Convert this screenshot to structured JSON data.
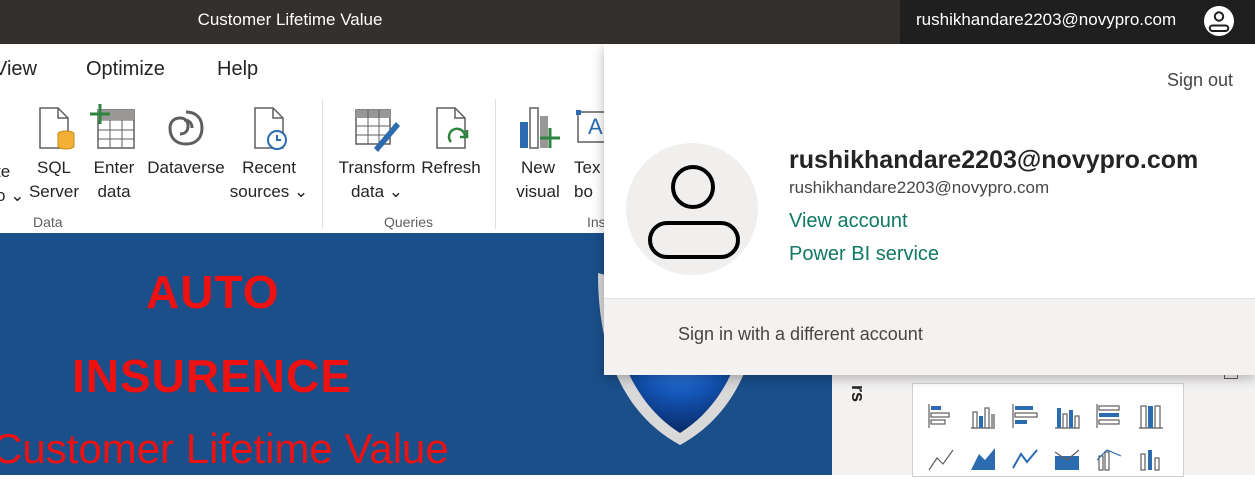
{
  "window": {
    "title": "Customer Lifetime Value"
  },
  "account": {
    "email": "rushikhandare2203@novypro.com",
    "display_name": "rushikhandare2203@novypro.com",
    "sub_email": "rushikhandare2203@novypro.com",
    "sign_out": "Sign out",
    "view_account": "View account",
    "power_bi_service": "Power BI service",
    "sign_in_different": "Sign in with a different account"
  },
  "menu": [
    "View",
    "Optimize",
    "Help"
  ],
  "ribbon": {
    "data_group": {
      "label": "Data",
      "partial": {
        "line1": "te",
        "line2": "o"
      },
      "sql_server": {
        "line1": "SQL",
        "line2": "Server"
      },
      "enter_data": {
        "line1": "Enter",
        "line2": "data"
      },
      "dataverse": {
        "line1": "Dataverse"
      },
      "recent_sources": {
        "line1": "Recent",
        "line2": "sources"
      }
    },
    "queries_group": {
      "label": "Queries",
      "transform_data": {
        "line1": "Transform",
        "line2": "data"
      },
      "refresh": {
        "line1": "Refresh"
      }
    },
    "insert_group": {
      "label": "Ins",
      "new_visual": {
        "line1": "New",
        "line2": "visual"
      },
      "text_box": {
        "line1": "Tex",
        "line2": "bo"
      }
    }
  },
  "canvas": {
    "title_line1": "AUTO",
    "title_line2": "INSURENCE",
    "title_line3": "Customer Lifetime Value"
  },
  "visualizations_pane": {
    "label_fragment": "rs"
  },
  "colors": {
    "titlebar": "#33302e",
    "link": "#117865",
    "canvas_bg": "#1a4f8a",
    "canvas_text": "#ee1111"
  }
}
